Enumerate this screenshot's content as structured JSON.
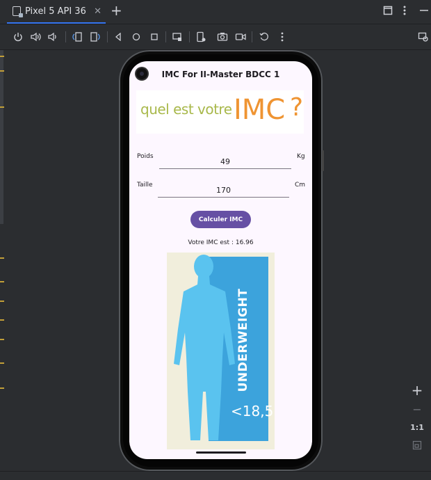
{
  "window": {
    "tab_label": "Pixel 5 API 36",
    "tab_close": "✕",
    "new_tab": "+"
  },
  "toolbar": {
    "icons": [
      "power-icon",
      "volume-up-icon",
      "volume-down-icon",
      "rotate-left-icon",
      "rotate-right-icon",
      "back-icon",
      "home-icon",
      "overview-icon",
      "snapshot-icon",
      "screenshot-icon",
      "record-icon",
      "reset-icon",
      "more-icon"
    ]
  },
  "app": {
    "title": "IMC For II-Master BDCC 1",
    "banner_small": "quel est votre",
    "banner_big": "IMC",
    "banner_q": "?",
    "weight_label": "Poids",
    "weight_value": "49",
    "weight_unit": "Kg",
    "height_label": "Taille",
    "height_value": "170",
    "height_unit": "Cm",
    "button_label": "Calculer IMC",
    "result_text": "Votre IMC est : 16.96",
    "figure_word": "UNDERWEIGHT",
    "figure_value": "<18,5"
  },
  "zoom": {
    "plus": "+",
    "minus": "−",
    "ratio": "1:1"
  },
  "colors": {
    "button": "#6650a4",
    "figure_blue": "#3ca3dc",
    "banner_green": "#a8b84a",
    "banner_orange": "#ef9432"
  }
}
